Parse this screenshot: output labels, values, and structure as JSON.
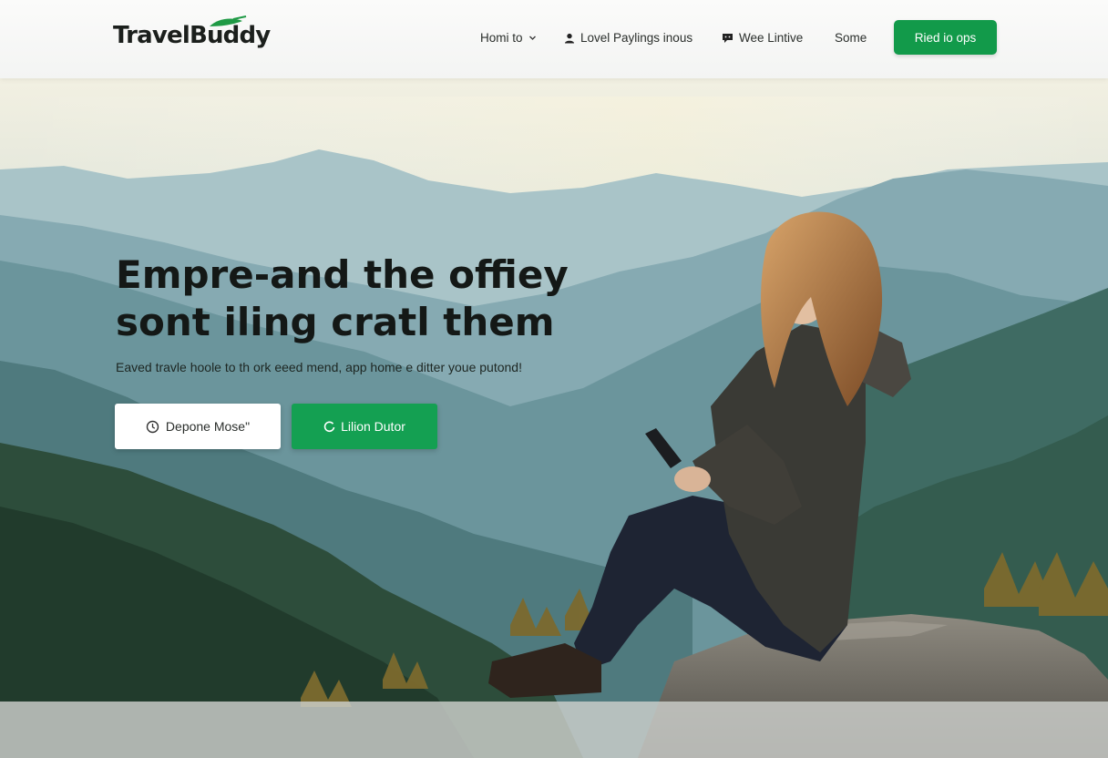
{
  "header": {
    "logo": "TravelBuddy",
    "nav": [
      {
        "label": "Homi to",
        "icon": "chevron-down-icon"
      },
      {
        "label": "Lovel Paylings inous",
        "icon": "user-icon"
      },
      {
        "label": "Wee Lintive",
        "icon": "chat-bubble-icon"
      },
      {
        "label": "Some",
        "icon": ""
      }
    ],
    "cta_label": "Ried io ops"
  },
  "hero": {
    "headline_line1": "Empre-and the offiey",
    "headline_line2": "sont iling cratl them",
    "subtext": "Eaved travle hoole to th ork eeed mend, app home e ditter youe putond!",
    "primary_button": {
      "label": "Depone Mose\"",
      "icon": "clock-icon"
    },
    "secondary_button": {
      "label": "Lilion Dutor",
      "icon": "refresh-icon"
    }
  },
  "colors": {
    "accent": "#129a4a",
    "accent_button": "#14a052",
    "header_bg": "#f6f7f6",
    "text_dark": "#141816"
  }
}
